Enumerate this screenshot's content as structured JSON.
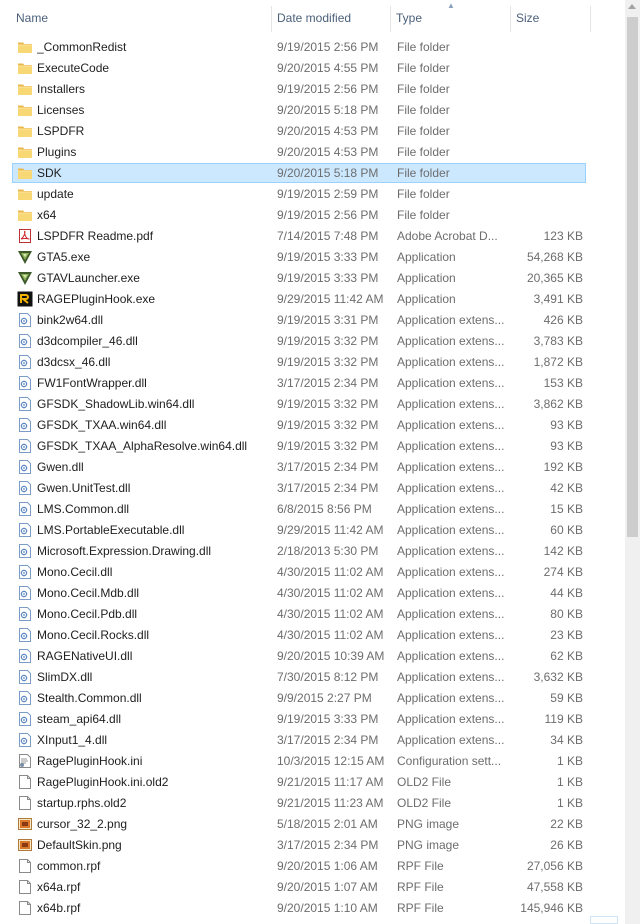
{
  "columns": {
    "name": "Name",
    "date": "Date modified",
    "type": "Type",
    "size": "Size"
  },
  "icons": {
    "folder": "folder-icon",
    "pdf": "pdf-icon",
    "gta": "gta-v-icon",
    "rage": "rage-icon",
    "dll": "dll-icon",
    "ini": "ini-icon",
    "file": "file-icon",
    "png": "png-icon"
  },
  "files": [
    {
      "name": "_CommonRedist",
      "date": "9/19/2015 2:56 PM",
      "type": "File folder",
      "size": "",
      "icon": "folder"
    },
    {
      "name": "ExecuteCode",
      "date": "9/20/2015 4:55 PM",
      "type": "File folder",
      "size": "",
      "icon": "folder"
    },
    {
      "name": "Installers",
      "date": "9/19/2015 2:56 PM",
      "type": "File folder",
      "size": "",
      "icon": "folder"
    },
    {
      "name": "Licenses",
      "date": "9/20/2015 5:18 PM",
      "type": "File folder",
      "size": "",
      "icon": "folder"
    },
    {
      "name": "LSPDFR",
      "date": "9/20/2015 4:53 PM",
      "type": "File folder",
      "size": "",
      "icon": "folder"
    },
    {
      "name": "Plugins",
      "date": "9/20/2015 4:53 PM",
      "type": "File folder",
      "size": "",
      "icon": "folder"
    },
    {
      "name": "SDK",
      "date": "9/20/2015 5:18 PM",
      "type": "File folder",
      "size": "",
      "icon": "folder",
      "selected": true
    },
    {
      "name": "update",
      "date": "9/19/2015 2:59 PM",
      "type": "File folder",
      "size": "",
      "icon": "folder"
    },
    {
      "name": "x64",
      "date": "9/19/2015 2:56 PM",
      "type": "File folder",
      "size": "",
      "icon": "folder"
    },
    {
      "name": "LSPDFR Readme.pdf",
      "date": "7/14/2015 7:48 PM",
      "type": "Adobe Acrobat D...",
      "size": "123 KB",
      "icon": "pdf"
    },
    {
      "name": "GTA5.exe",
      "date": "9/19/2015 3:33 PM",
      "type": "Application",
      "size": "54,268 KB",
      "icon": "gta"
    },
    {
      "name": "GTAVLauncher.exe",
      "date": "9/19/2015 3:33 PM",
      "type": "Application",
      "size": "20,365 KB",
      "icon": "gta"
    },
    {
      "name": "RAGEPluginHook.exe",
      "date": "9/29/2015 11:42 AM",
      "type": "Application",
      "size": "3,491 KB",
      "icon": "rage"
    },
    {
      "name": "bink2w64.dll",
      "date": "9/19/2015 3:31 PM",
      "type": "Application extens...",
      "size": "426 KB",
      "icon": "dll"
    },
    {
      "name": "d3dcompiler_46.dll",
      "date": "9/19/2015 3:32 PM",
      "type": "Application extens...",
      "size": "3,783 KB",
      "icon": "dll"
    },
    {
      "name": "d3dcsx_46.dll",
      "date": "9/19/2015 3:32 PM",
      "type": "Application extens...",
      "size": "1,872 KB",
      "icon": "dll"
    },
    {
      "name": "FW1FontWrapper.dll",
      "date": "3/17/2015 2:34 PM",
      "type": "Application extens...",
      "size": "153 KB",
      "icon": "dll"
    },
    {
      "name": "GFSDK_ShadowLib.win64.dll",
      "date": "9/19/2015 3:32 PM",
      "type": "Application extens...",
      "size": "3,862 KB",
      "icon": "dll"
    },
    {
      "name": "GFSDK_TXAA.win64.dll",
      "date": "9/19/2015 3:32 PM",
      "type": "Application extens...",
      "size": "93 KB",
      "icon": "dll"
    },
    {
      "name": "GFSDK_TXAA_AlphaResolve.win64.dll",
      "date": "9/19/2015 3:32 PM",
      "type": "Application extens...",
      "size": "93 KB",
      "icon": "dll"
    },
    {
      "name": "Gwen.dll",
      "date": "3/17/2015 2:34 PM",
      "type": "Application extens...",
      "size": "192 KB",
      "icon": "dll"
    },
    {
      "name": "Gwen.UnitTest.dll",
      "date": "3/17/2015 2:34 PM",
      "type": "Application extens...",
      "size": "42 KB",
      "icon": "dll"
    },
    {
      "name": "LMS.Common.dll",
      "date": "6/8/2015 8:56 PM",
      "type": "Application extens...",
      "size": "15 KB",
      "icon": "dll"
    },
    {
      "name": "LMS.PortableExecutable.dll",
      "date": "9/29/2015 11:42 AM",
      "type": "Application extens...",
      "size": "60 KB",
      "icon": "dll"
    },
    {
      "name": "Microsoft.Expression.Drawing.dll",
      "date": "2/18/2013 5:30 PM",
      "type": "Application extens...",
      "size": "142 KB",
      "icon": "dll"
    },
    {
      "name": "Mono.Cecil.dll",
      "date": "4/30/2015 11:02 AM",
      "type": "Application extens...",
      "size": "274 KB",
      "icon": "dll"
    },
    {
      "name": "Mono.Cecil.Mdb.dll",
      "date": "4/30/2015 11:02 AM",
      "type": "Application extens...",
      "size": "44 KB",
      "icon": "dll"
    },
    {
      "name": "Mono.Cecil.Pdb.dll",
      "date": "4/30/2015 11:02 AM",
      "type": "Application extens...",
      "size": "80 KB",
      "icon": "dll"
    },
    {
      "name": "Mono.Cecil.Rocks.dll",
      "date": "4/30/2015 11:02 AM",
      "type": "Application extens...",
      "size": "23 KB",
      "icon": "dll"
    },
    {
      "name": "RAGENativeUI.dll",
      "date": "9/20/2015 10:39 AM",
      "type": "Application extens...",
      "size": "62 KB",
      "icon": "dll"
    },
    {
      "name": "SlimDX.dll",
      "date": "7/30/2015 8:12 PM",
      "type": "Application extens...",
      "size": "3,632 KB",
      "icon": "dll"
    },
    {
      "name": "Stealth.Common.dll",
      "date": "9/9/2015 2:27 PM",
      "type": "Application extens...",
      "size": "59 KB",
      "icon": "dll"
    },
    {
      "name": "steam_api64.dll",
      "date": "9/19/2015 3:33 PM",
      "type": "Application extens...",
      "size": "119 KB",
      "icon": "dll"
    },
    {
      "name": "XInput1_4.dll",
      "date": "3/17/2015 2:34 PM",
      "type": "Application extens...",
      "size": "34 KB",
      "icon": "dll"
    },
    {
      "name": "RagePluginHook.ini",
      "date": "10/3/2015 12:15 AM",
      "type": "Configuration sett...",
      "size": "1 KB",
      "icon": "ini"
    },
    {
      "name": "RagePluginHook.ini.old2",
      "date": "9/21/2015 11:17 AM",
      "type": "OLD2 File",
      "size": "1 KB",
      "icon": "file"
    },
    {
      "name": "startup.rphs.old2",
      "date": "9/21/2015 11:23 AM",
      "type": "OLD2 File",
      "size": "1 KB",
      "icon": "file"
    },
    {
      "name": "cursor_32_2.png",
      "date": "5/18/2015 2:01 AM",
      "type": "PNG image",
      "size": "22 KB",
      "icon": "png"
    },
    {
      "name": "DefaultSkin.png",
      "date": "3/17/2015 2:34 PM",
      "type": "PNG image",
      "size": "26 KB",
      "icon": "png"
    },
    {
      "name": "common.rpf",
      "date": "9/20/2015 1:06 AM",
      "type": "RPF File",
      "size": "27,056 KB",
      "icon": "file"
    },
    {
      "name": "x64a.rpf",
      "date": "9/20/2015 1:07 AM",
      "type": "RPF File",
      "size": "47,558 KB",
      "icon": "file"
    },
    {
      "name": "x64b.rpf",
      "date": "9/20/2015 1:10 AM",
      "type": "RPF File",
      "size": "145,946 KB",
      "icon": "file"
    }
  ]
}
